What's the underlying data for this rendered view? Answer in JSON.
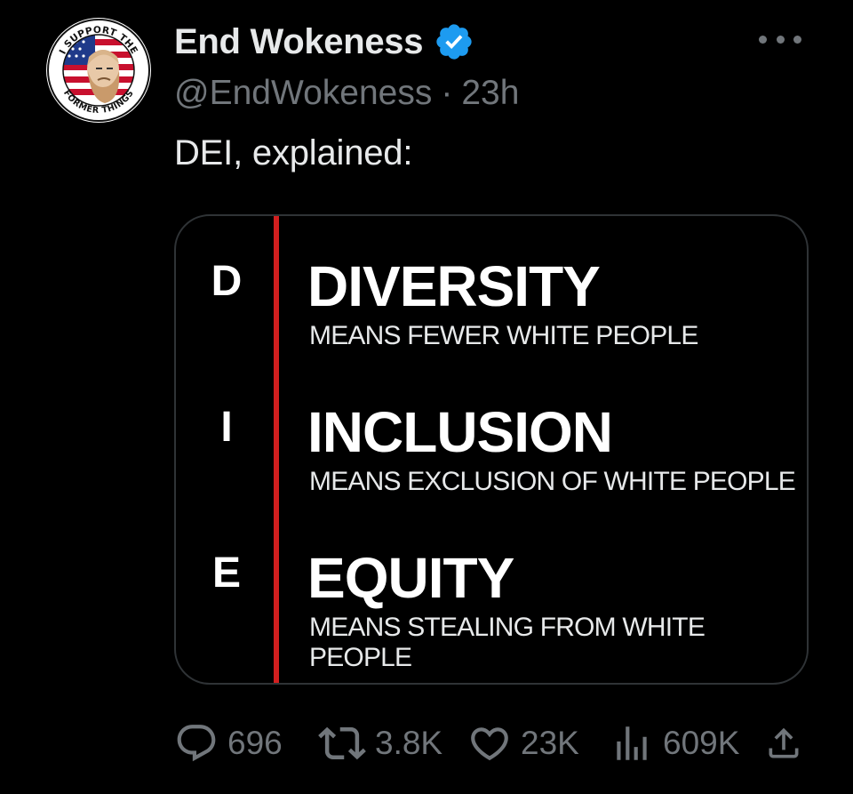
{
  "tweet": {
    "display_name": "End Wokeness",
    "handle": "@EndWokeness",
    "separator": "·",
    "time_ago": "23h",
    "text": "DEI, explained:",
    "avatar_text_top": "I SUPPORT THE",
    "avatar_text_bottom": "FORMER THINGS"
  },
  "media": {
    "rows": [
      {
        "letter": "D",
        "word": "DIVERSITY",
        "desc": "MEANS FEWER WHITE PEOPLE"
      },
      {
        "letter": "I",
        "word": "INCLUSION",
        "desc": "MEANS EXCLUSION OF WHITE PEOPLE"
      },
      {
        "letter": "E",
        "word": "EQUITY",
        "desc": "MEANS STEALING FROM WHITE PEOPLE"
      }
    ],
    "accent_color": "#d21f1f"
  },
  "actions": {
    "replies": "696",
    "reposts": "3.8K",
    "likes": "23K",
    "views": "609K"
  },
  "colors": {
    "background": "#000000",
    "text": "#e7e9ea",
    "muted": "#71767b",
    "verified": "#1d9bf0"
  }
}
